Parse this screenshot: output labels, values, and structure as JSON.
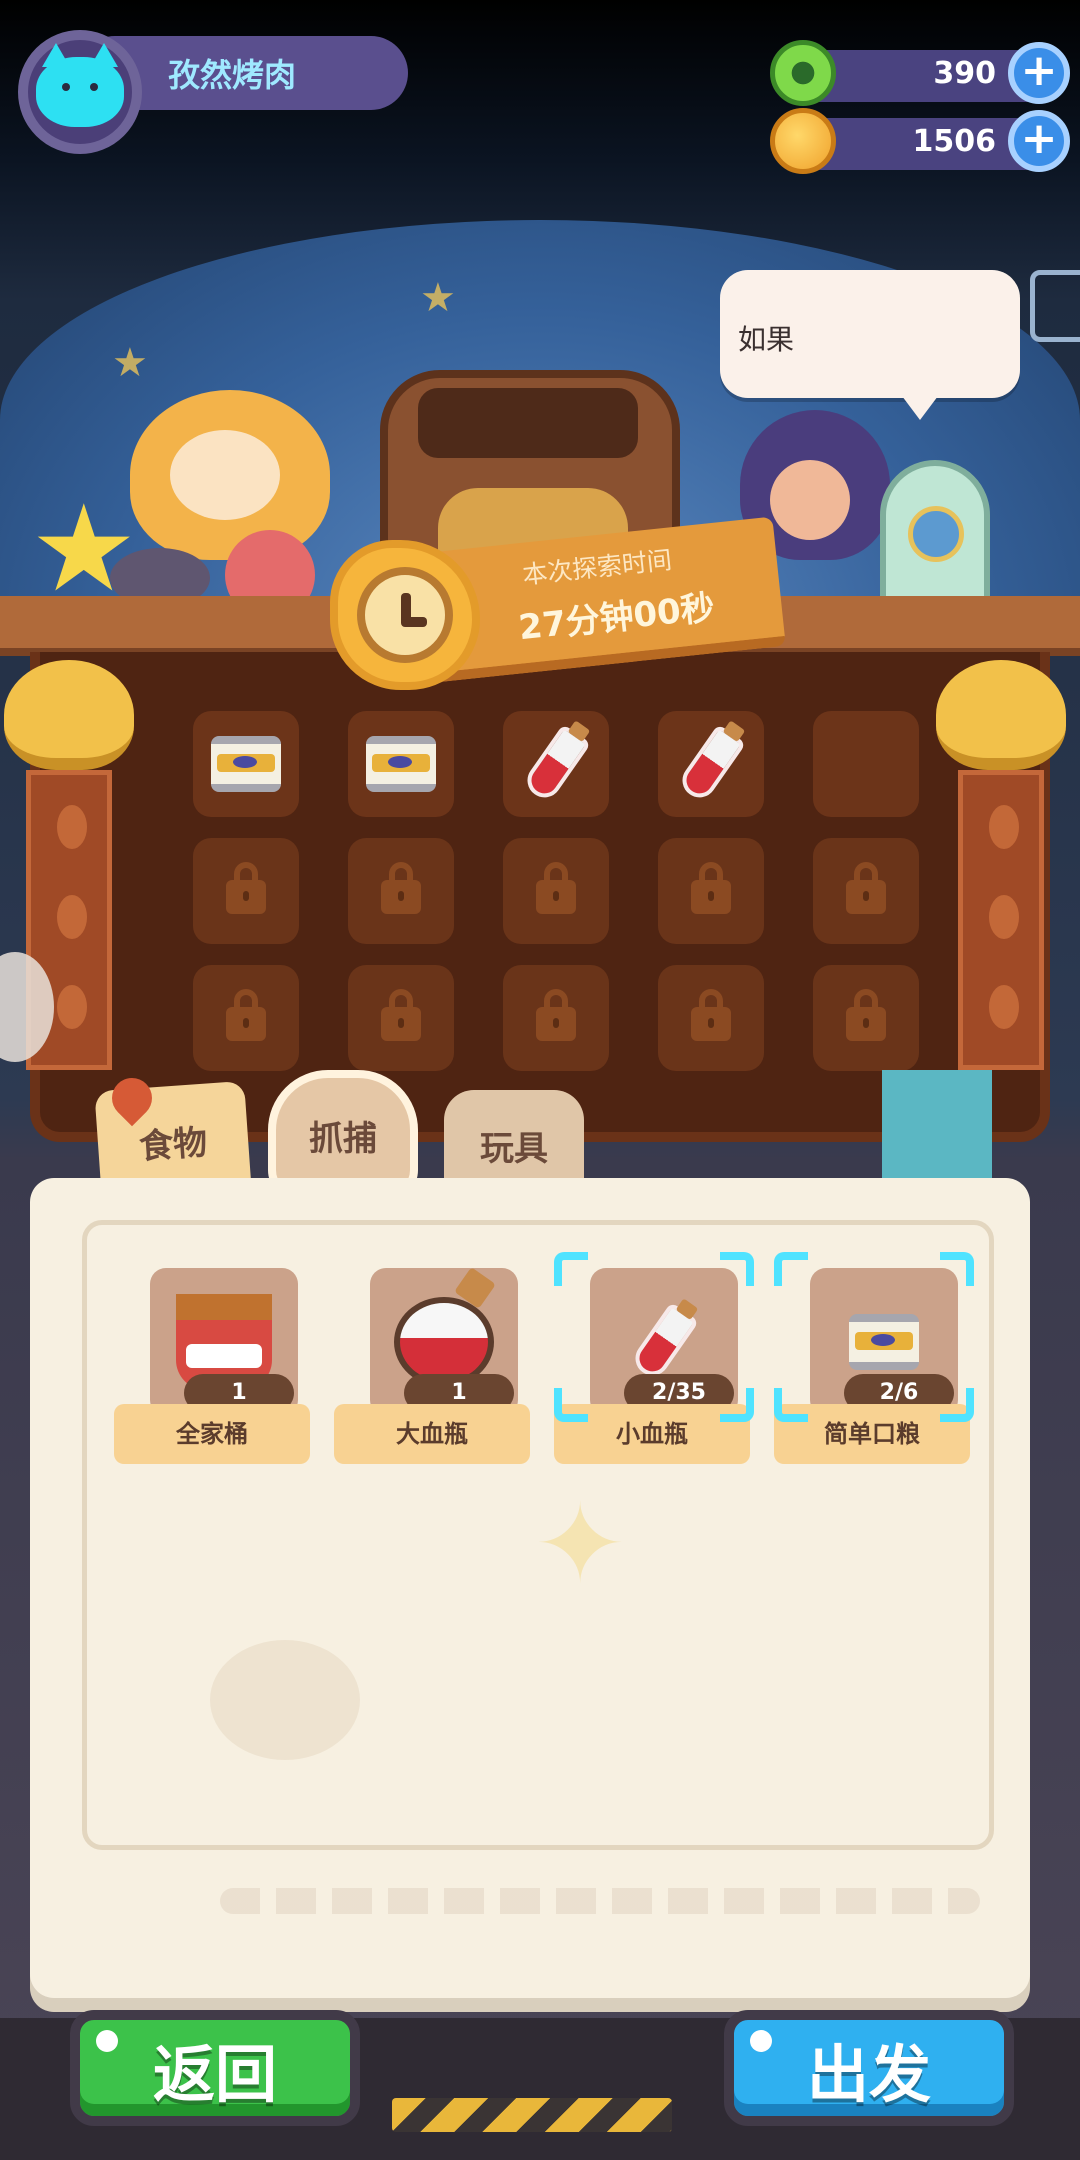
{
  "player": {
    "name": "孜然烤肉"
  },
  "currencies": [
    {
      "icon": "green-coin-icon",
      "value": "390"
    },
    {
      "icon": "planet-coin-icon",
      "value": "1506"
    }
  ],
  "scene": {
    "speech": "如果"
  },
  "timer": {
    "label": "本次探索时间",
    "value": "27分钟00秒"
  },
  "tabs": [
    {
      "label": "食物",
      "selected": false
    },
    {
      "label": "抓捕",
      "selected": true
    },
    {
      "label": "玩具",
      "selected": false
    }
  ],
  "items": [
    {
      "name": "全家桶",
      "count": "1",
      "icon": "chicken-bucket-icon",
      "selected": false
    },
    {
      "name": "大血瓶",
      "count": "1",
      "icon": "large-potion-icon",
      "selected": false
    },
    {
      "name": "小血瓶",
      "count": "2/35",
      "icon": "small-potion-icon",
      "selected": true
    },
    {
      "name": "简单口粮",
      "count": "2/6",
      "icon": "canned-food-icon",
      "selected": true
    }
  ],
  "backpack_slots": [
    "canned-food",
    "canned-food",
    "small-potion",
    "small-potion",
    "empty",
    "locked",
    "locked",
    "locked",
    "locked",
    "locked",
    "locked",
    "locked",
    "locked",
    "locked",
    "locked"
  ],
  "buttons": {
    "back": "返回",
    "go": "出发"
  },
  "colors": {
    "back_button": "#3cc24a",
    "go_button": "#2fb0f0",
    "selection": "#4fe3ff",
    "board": "#4f2412"
  }
}
